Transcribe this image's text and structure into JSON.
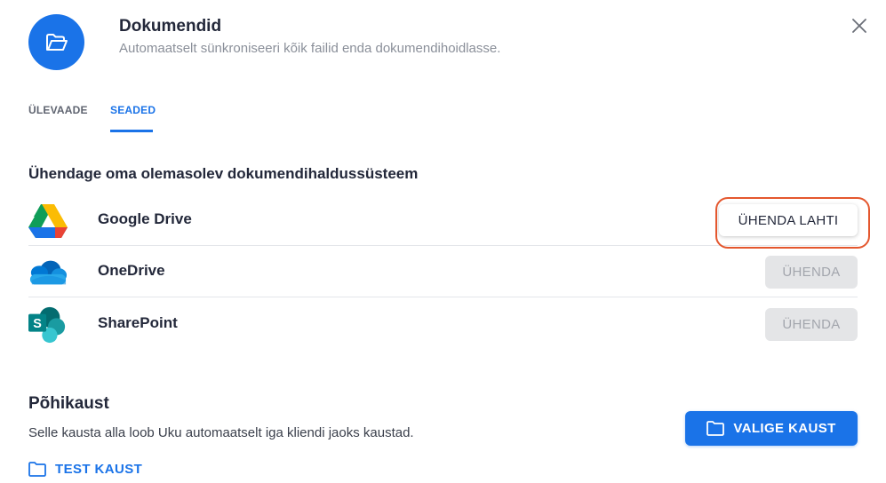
{
  "header": {
    "title": "Dokumendid",
    "subtitle": "Automaatselt sünkroniseeri kõik failid enda dokumendihoidlasse.",
    "icon": "folder-open-icon"
  },
  "tabs": [
    {
      "label": "ÜLEVAADE",
      "active": false
    },
    {
      "label": "SEADED",
      "active": true
    }
  ],
  "integrations": {
    "title": "Ühendage oma olemasolev dokumendihaldussüsteem",
    "services": [
      {
        "name": "Google Drive",
        "icon": "google-drive-icon",
        "action": "ÜHENDA LAHTI",
        "connected": true
      },
      {
        "name": "OneDrive",
        "icon": "onedrive-icon",
        "action": "ÜHENDA",
        "connected": false
      },
      {
        "name": "SharePoint",
        "icon": "sharepoint-icon",
        "action": "ÜHENDA",
        "connected": false
      }
    ]
  },
  "main_folder": {
    "title": "Põhikaust",
    "description": "Selle kausta alla loob Uku automaatselt iga kliendi jaoks kaustad.",
    "choose_label": "VALIGE KAUST",
    "current_folder": "TEST KAUST"
  },
  "colors": {
    "accent": "#1a73e8",
    "highlight": "#e4572e",
    "disabled_bg": "#e4e5e7"
  }
}
